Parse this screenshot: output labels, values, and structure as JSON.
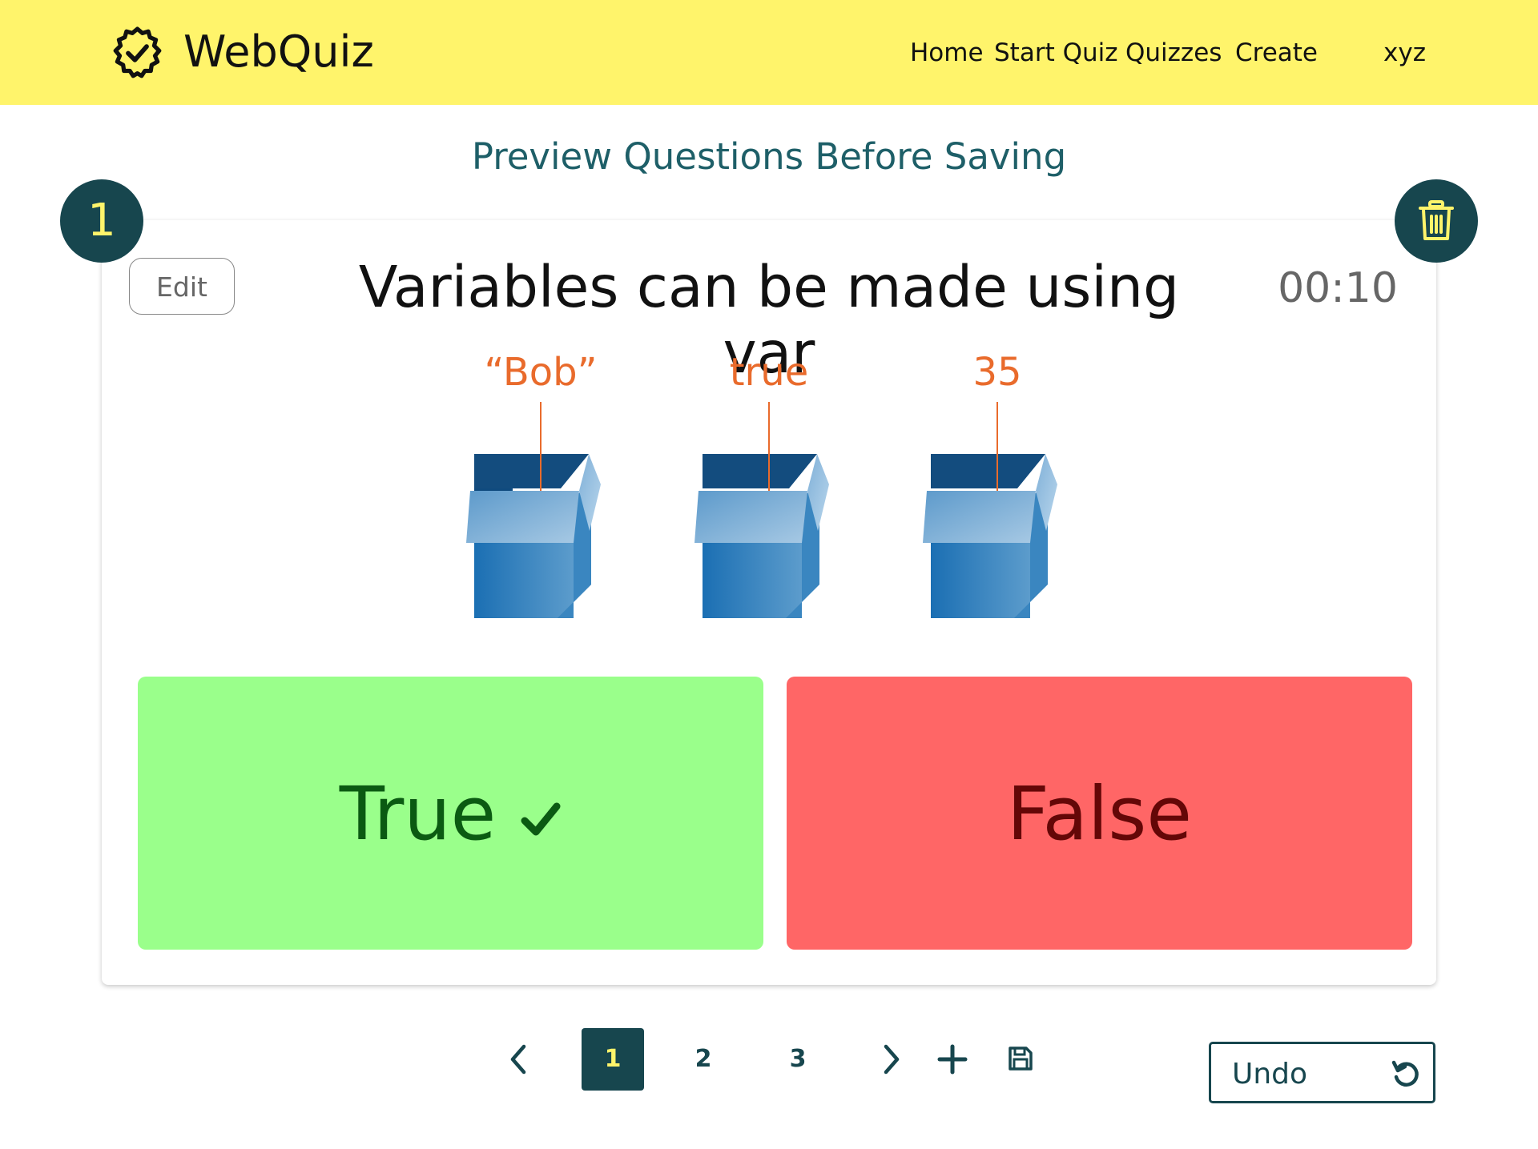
{
  "header": {
    "brand": "WebQuiz",
    "nav": {
      "home": "Home",
      "start_quiz": "Start Quiz",
      "quizzes": "Quizzes",
      "create": "Create",
      "user": "xyz"
    },
    "background_color": "#fff46b"
  },
  "page": {
    "title": "Preview Questions Before Saving"
  },
  "question_card": {
    "number": "1",
    "edit_label": "Edit",
    "question_text": "Variables can be made using var",
    "timer": "00:10",
    "illustration_labels": [
      "“Bob”",
      "true",
      "35"
    ],
    "answers": {
      "true_label": "True",
      "false_label": "False",
      "correct": "true"
    },
    "colors": {
      "accent": "#17464e",
      "true_bg": "#9aff8b",
      "false_bg": "#ff6666",
      "label_orange": "#e96b2c"
    }
  },
  "pagination": {
    "pages": [
      "1",
      "2",
      "3"
    ],
    "current_page": "1"
  },
  "undo": {
    "label": "Undo"
  }
}
